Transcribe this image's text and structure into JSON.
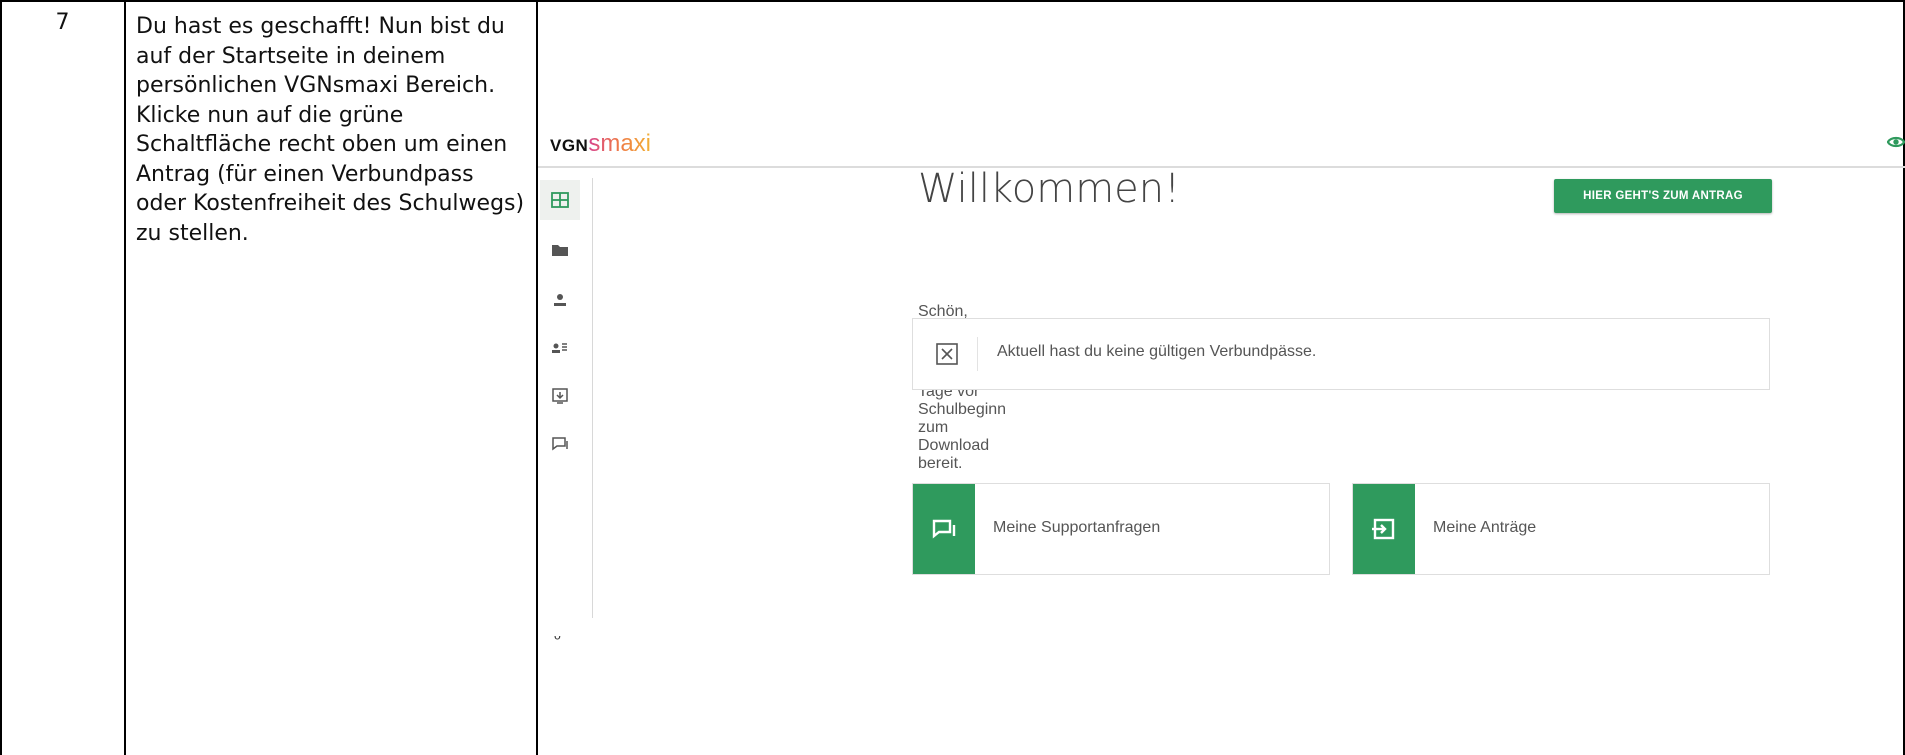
{
  "document": {
    "step_number": "7",
    "instruction": "Du hast es geschafft! Nun bist du auf der Startseite in deinem persönlichen VGNsmaxi Bereich. Klicke nun auf die grüne Schaltfläche recht oben um einen Antrag (für einen Verbundpass oder Kostenfreiheit des Schulwegs) zu stellen."
  },
  "app": {
    "logo_vgn": "VGN",
    "logo_smaxi": "smaxi",
    "header_icon": "eye-icon",
    "sidebar": [
      {
        "icon": "dashboard-icon",
        "active": true
      },
      {
        "icon": "folder-icon",
        "active": false
      },
      {
        "icon": "person-icon",
        "active": false
      },
      {
        "icon": "person-list-icon",
        "active": false
      },
      {
        "icon": "download-icon",
        "active": false
      },
      {
        "icon": "chat-icon",
        "active": false
      }
    ],
    "sidebar_tail": "ᵕ",
    "main": {
      "title": "Willkommen!",
      "cta_label": "HIER GEHT'S ZUM ANTRAG",
      "subtitle_1": "Schön, dass du da bist.",
      "subtitle_2": "Deine aktiven Verbundpässe stehen 60 Tage vor Schulbeginn zum Download bereit.",
      "notice_text": "Aktuell hast du keine gültigen Verbundpässe.",
      "cards": [
        {
          "icon": "support-chat-icon",
          "label": "Meine Supportanfragen"
        },
        {
          "icon": "application-enter-icon",
          "label": "Meine Anträge"
        }
      ]
    },
    "colors": {
      "brand_green": "#2f9a5d",
      "logo_gradient_start": "#d6428e",
      "logo_gradient_end": "#f2b136"
    }
  }
}
